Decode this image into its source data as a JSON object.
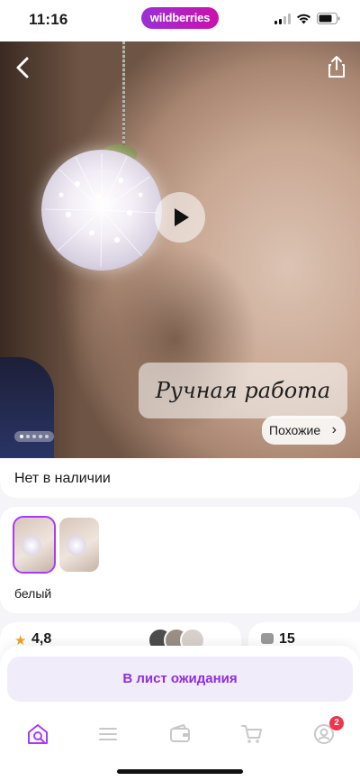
{
  "status_bar": {
    "time": "11:16",
    "brand": "wildberries"
  },
  "hero": {
    "handmade_label": "Ручная работа",
    "similar_label": "Похожие",
    "slide_count": 5,
    "active_slide": 1
  },
  "product": {
    "stock_status": "Нет в наличии",
    "color_name": "белый"
  },
  "rating": {
    "value": "4,8"
  },
  "questions": {
    "count": "15"
  },
  "actions": {
    "waitlist_label": "В лист ожидания"
  },
  "tabbar": {
    "items": [
      {
        "icon": "home-search-icon",
        "active": true
      },
      {
        "icon": "catalog-menu-icon",
        "active": false
      },
      {
        "icon": "wallet-icon",
        "active": false
      },
      {
        "icon": "cart-icon",
        "active": false
      },
      {
        "icon": "profile-icon",
        "active": false
      }
    ],
    "profile_badge": "2"
  },
  "colors": {
    "accent": "#a73afd",
    "badge": "#f1344b",
    "brand_from": "#9b2fd6",
    "brand_to": "#cb11ab"
  }
}
